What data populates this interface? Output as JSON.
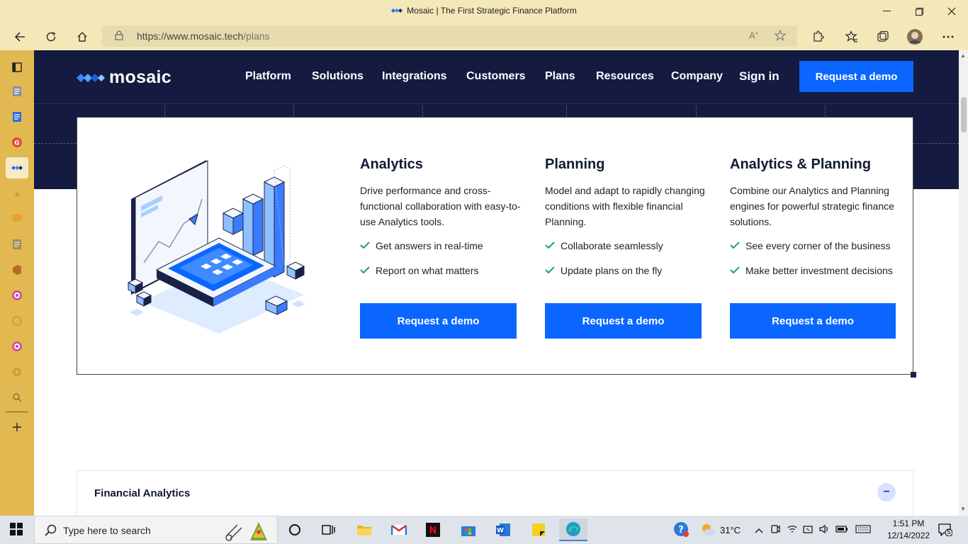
{
  "browser": {
    "window_title": "Mosaic | The First Strategic Finance Platform",
    "url_base": "https://www.mosaic.tech",
    "url_path": "/plans"
  },
  "nav": {
    "brand": "mosaic",
    "menu": [
      "Platform",
      "Solutions",
      "Integrations",
      "Customers",
      "Plans",
      "Resources",
      "Company"
    ],
    "sign_in": "Sign in",
    "cta": "Request a demo"
  },
  "plans": [
    {
      "title": "Analytics",
      "description": "Drive performance and cross-functional collaboration with easy-to-use Analytics tools.",
      "features": [
        "Get answers in real-time",
        "Report on what matters"
      ],
      "cta": "Request a demo"
    },
    {
      "title": "Planning",
      "description": "Model and adapt to rapidly changing conditions with flexible financial Planning.",
      "features": [
        "Collaborate seamlessly",
        "Update plans on the fly"
      ],
      "cta": "Request a demo"
    },
    {
      "title": "Analytics & Planning",
      "description": "Combine our Analytics and Planning engines for powerful strategic finance solutions.",
      "features": [
        "See every corner of the business",
        "Make better investment decisions"
      ],
      "cta": "Request a demo"
    }
  ],
  "accordion": {
    "label": "Financial Analytics",
    "toggle": "−"
  },
  "taskbar": {
    "search_placeholder": "Type here to search",
    "weather": "31°C",
    "time": "1:51 PM",
    "date": "12/14/2022",
    "notifications": "5"
  },
  "colors": {
    "nav_bg": "#141a40",
    "accent": "#0a66ff",
    "check": "#22a06b",
    "browser_chrome": "#f4e8b8",
    "sidebar": "#e2b850"
  }
}
